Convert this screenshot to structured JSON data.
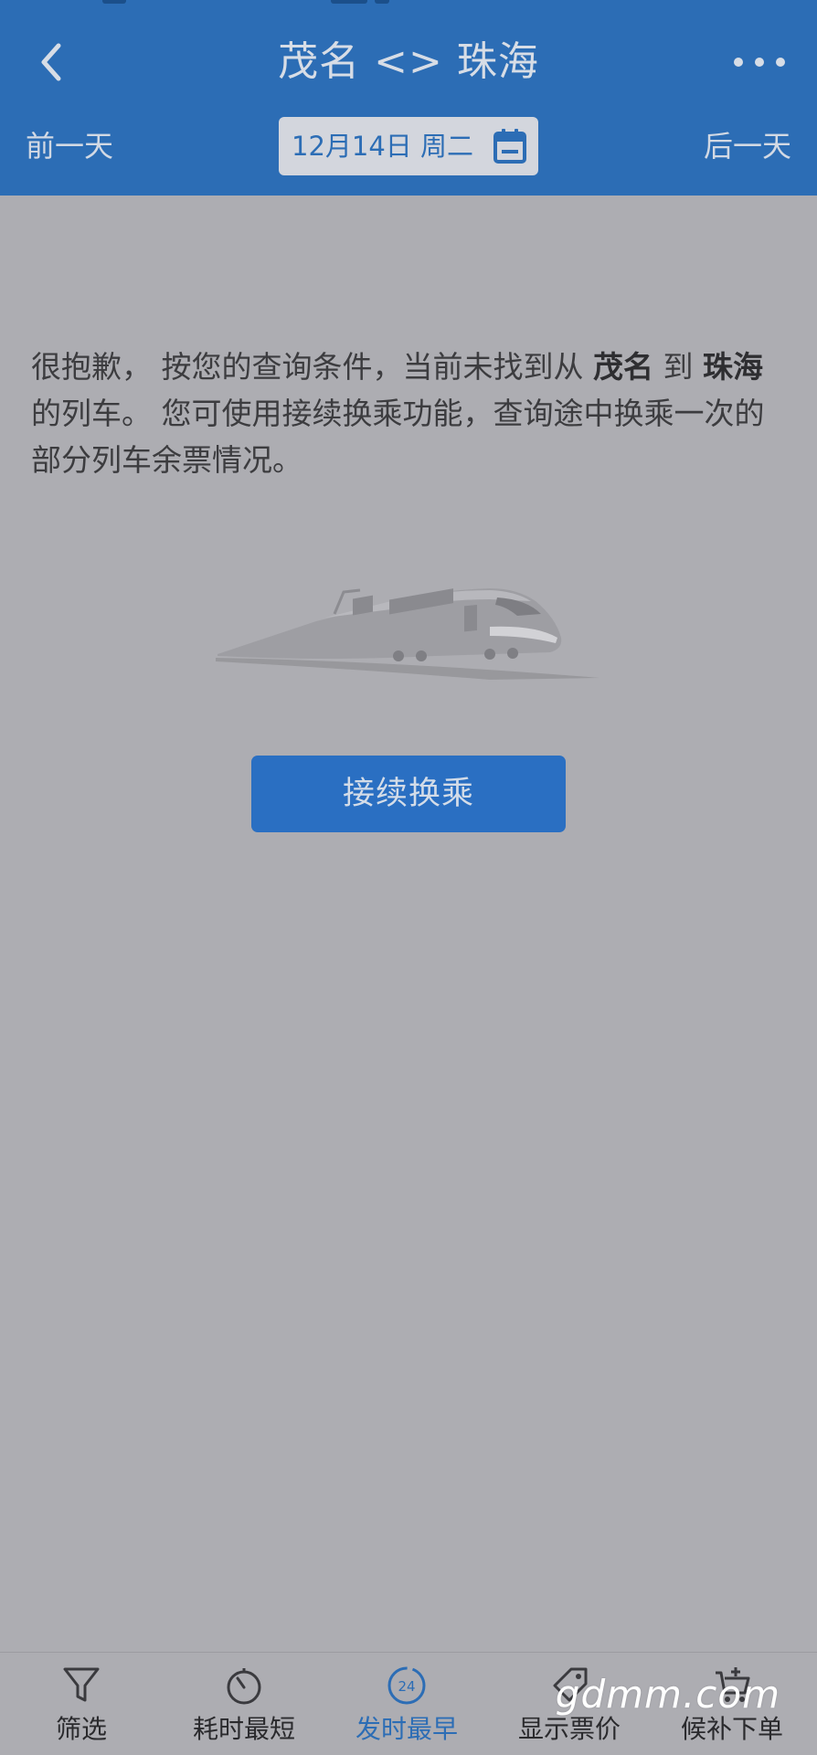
{
  "header": {
    "title": "茂名 <> 珠海",
    "prev_day": "前一天",
    "next_day": "后一天",
    "date": "12月14日 周二"
  },
  "message": {
    "part1": "很抱歉， 按您的查询条件，当前未找到从 ",
    "from": "茂名",
    "part2": " 到 ",
    "to": "珠海",
    "part3": " 的列车。 您可使用接续换乘功能，查询途中换乘一次的部分列车余票情况。"
  },
  "transfer_button": "接续换乘",
  "bottom_tabs": [
    {
      "label": "筛选",
      "icon": "filter-icon",
      "active": false
    },
    {
      "label": "耗时最短",
      "icon": "timer-icon",
      "active": false
    },
    {
      "label": "发时最早",
      "icon": "clock-24-icon",
      "active": true
    },
    {
      "label": "显示票价",
      "icon": "price-tag-icon",
      "active": false
    },
    {
      "label": "候补下单",
      "icon": "cart-add-icon",
      "active": false
    }
  ],
  "watermark": "gdmm.com",
  "colors": {
    "primary": "#2c6db5",
    "background": "#adadb2"
  }
}
